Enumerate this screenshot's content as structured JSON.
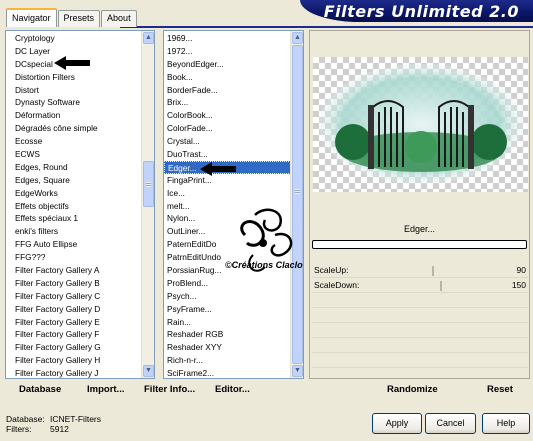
{
  "window": {
    "title": "Filters Unlimited 2.0"
  },
  "tabs": [
    {
      "label": "Navigator",
      "active": true
    },
    {
      "label": "Presets",
      "active": false
    },
    {
      "label": "About",
      "active": false
    }
  ],
  "categories": [
    "Cryptology",
    "DC Layer",
    "DCspecial",
    "Distortion Filters",
    "Distort",
    "Dynasty Software",
    "Déformation",
    "Dégradés cône simple",
    "Ecosse",
    "ECWS",
    "Edges, Round",
    "Edges, Square",
    "EdgeWorks",
    "Effets objectifs",
    "Effets spéciaux 1",
    "enki's filters",
    "FFG Auto Ellipse",
    "FFG???",
    "Filter Factory Gallery A",
    "Filter Factory Gallery B",
    "Filter Factory Gallery C",
    "Filter Factory Gallery D",
    "Filter Factory Gallery E",
    "Filter Factory Gallery F",
    "Filter Factory Gallery G",
    "Filter Factory Gallery H",
    "Filter Factory Gallery J"
  ],
  "filters": [
    "1969...",
    "1972...",
    "BeyondEdger...",
    "Book...",
    "BorderFade...",
    "Brix...",
    "ColorBook...",
    "ColorFade...",
    "Crystal...",
    "DuoTrast...",
    "Edger...",
    "FingaPrint...",
    "Ice...",
    "melt...",
    "Nylon...",
    "OutLiner...",
    "PaternEditDo",
    "PatrnEditUndo",
    "PorssianRug...",
    "ProBlend...",
    "Psych...",
    "PsyFrame...",
    "Rain...",
    "Reshader RGB",
    "Reshader XYY",
    "Rich-n-r...",
    "SciFrame2..."
  ],
  "selected_filter_index": 10,
  "preview": {
    "filter_name": "Edger..."
  },
  "watermark": {
    "text": "©Créations Claclo"
  },
  "sliders": [
    {
      "label": "ScaleUp:",
      "value": "90"
    },
    {
      "label": "ScaleDown:",
      "value": "150"
    }
  ],
  "toolbar": {
    "database": "Database",
    "import": "Import...",
    "filter_info": "Filter Info...",
    "editor": "Editor...",
    "randomize": "Randomize",
    "reset": "Reset"
  },
  "status": {
    "database_label": "Database:",
    "database_value": "ICNET-Filters",
    "filters_label": "Filters:",
    "filters_value": "5912"
  },
  "buttons": {
    "apply": "Apply",
    "cancel": "Cancel",
    "help": "Help"
  },
  "colors": {
    "selection": "#316ac5",
    "banner": "#0b1668",
    "tab_accent": "#f9b33c"
  }
}
